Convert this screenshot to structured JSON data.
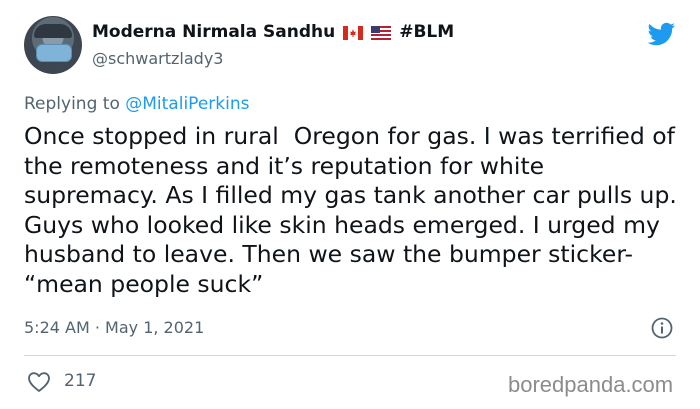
{
  "author": {
    "display_name": "Moderna Nirmala Sandhu",
    "flags": [
      "canada-flag",
      "us-flag"
    ],
    "hashtag": "#BLM",
    "handle": "@schwartzlady3"
  },
  "reply": {
    "prefix": "Replying to",
    "mention": "@MitaliPerkins"
  },
  "tweet": {
    "text": "Once stopped in rural  Oregon for gas. I was terrified of the remoteness and it’s reputation for white supremacy. As I filled my gas tank another car pulls up. Guys who looked like skin heads emerged. I urged my husband to leave. Then we saw the bumper sticker- “mean people suck”",
    "timestamp": "5:24 AM · May 1, 2021"
  },
  "engagement": {
    "likes": "217"
  },
  "watermark": "boredpanda.com",
  "colors": {
    "twitter_blue": "#1d9bf0",
    "secondary_text": "#536471",
    "divider": "#cfd9de"
  }
}
